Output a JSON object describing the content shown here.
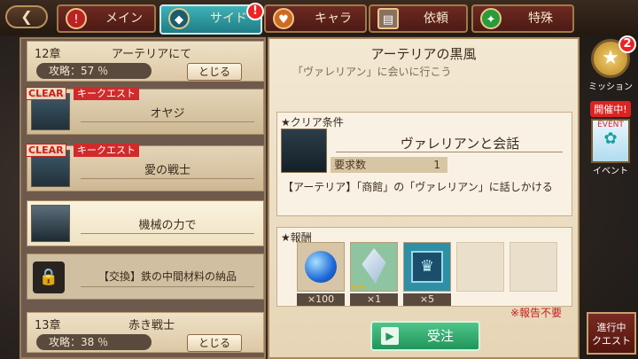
{
  "nav": {
    "tabs": [
      {
        "label": "メイン"
      },
      {
        "label": "サイド"
      },
      {
        "label": "キャラ"
      },
      {
        "label": "依頼"
      },
      {
        "label": "特殊"
      }
    ],
    "side_badge": "!",
    "main_badge": "!"
  },
  "chapters": [
    {
      "name": "12章",
      "title": "アーテリアにて",
      "rate": "攻略：57 ％",
      "close_label": "とじる"
    },
    {
      "name": "13章",
      "title": "赤き戦士",
      "rate": "攻略：38 ％",
      "close_label": "とじる"
    }
  ],
  "quests": [
    {
      "name": "オヤジ",
      "clear": "CLEAR",
      "tag": "キークエスト"
    },
    {
      "name": "愛の戦士",
      "clear": "CLEAR",
      "tag": "キークエスト"
    },
    {
      "name": "機械の力で"
    },
    {
      "name": "【交換】鉄の中間材料の納品"
    }
  ],
  "detail": {
    "title": "アーテリアの黒風",
    "subtitle": "「ヴァレリアン」に会いに行こう",
    "cond_header": "クリア条件",
    "cond_name": "ヴァレリアンと会話",
    "req_label": "要求数",
    "req_value": "1",
    "cond_desc": "【アーテリア】「商館」の「ヴァレリアン」に話しかける",
    "reward_header": "報酬",
    "rewards": [
      {
        "count": "×100",
        "icon": "blue-orb"
      },
      {
        "count": "×1",
        "icon": "feather-quill",
        "stars": "★★"
      },
      {
        "count": "×5",
        "icon": "crown-box"
      }
    ],
    "note": "※報告不要",
    "accept_label": "受注"
  },
  "side": {
    "mission_label": "ミッション",
    "mission_count": "2",
    "kaisai": "開催中!",
    "event_tag": "EVENT",
    "event_label": "イベント",
    "progress_label_1": "進行中",
    "progress_label_2": "クエスト"
  },
  "colors": {
    "accent": "#2aa0a8",
    "tab": "#6e2a22",
    "red": "#d12a2a",
    "accept": "#21955a"
  }
}
